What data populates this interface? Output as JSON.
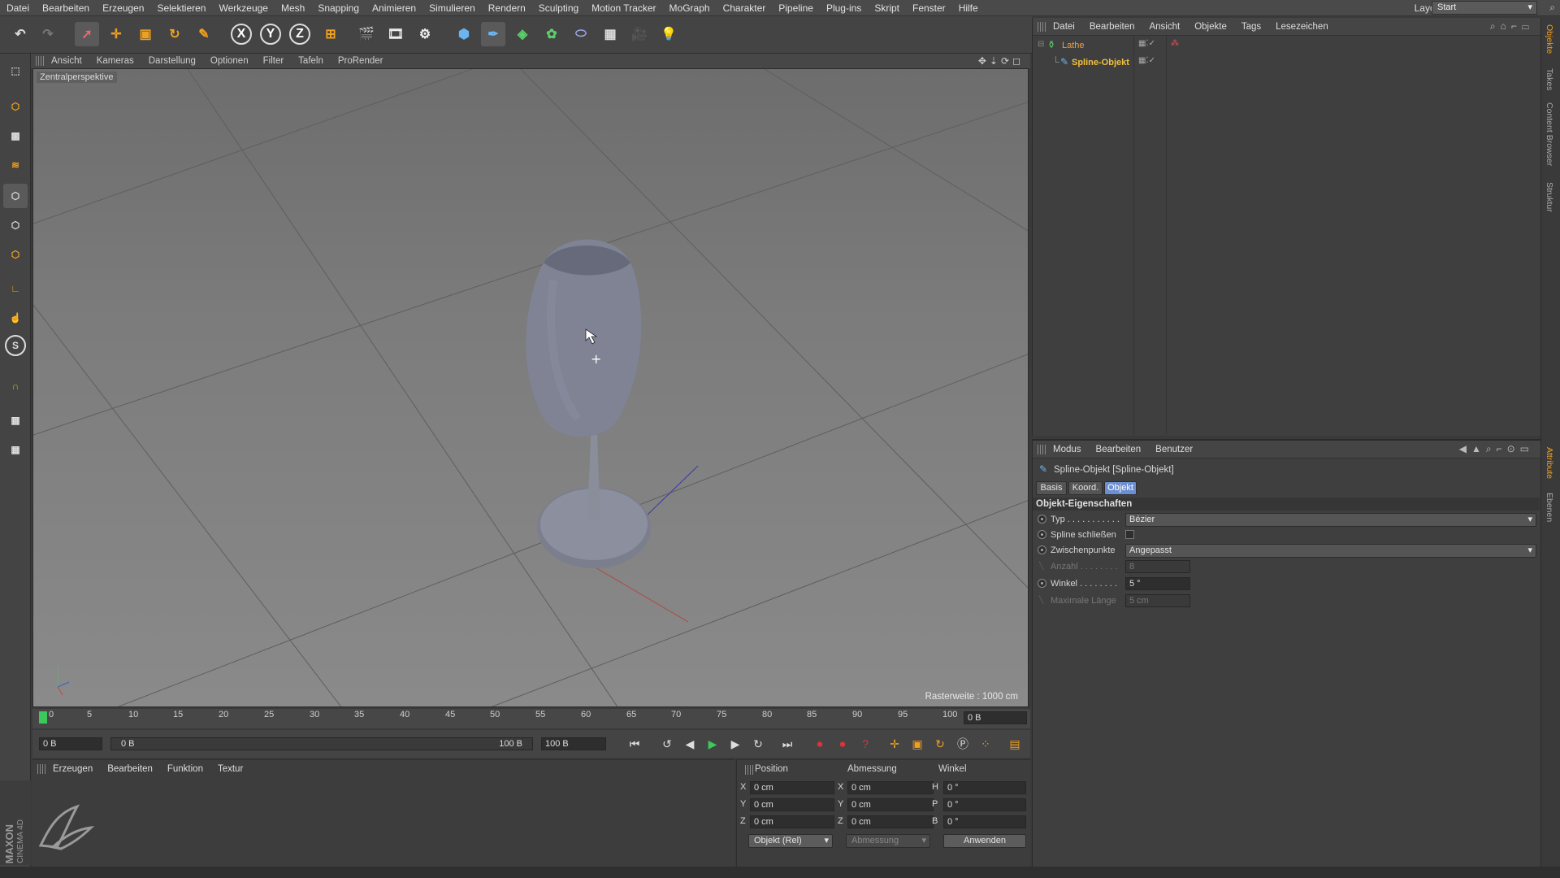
{
  "menubar": {
    "items": [
      "Datei",
      "Bearbeiten",
      "Erzeugen",
      "Selektieren",
      "Werkzeuge",
      "Mesh",
      "Snapping",
      "Animieren",
      "Simulieren",
      "Rendern",
      "Sculpting",
      "Motion Tracker",
      "MoGraph",
      "Charakter",
      "Pipeline",
      "Plug-ins",
      "Skript",
      "Fenster",
      "Hilfe"
    ],
    "layout_label": "Layout:",
    "layout_value": "Start"
  },
  "toolbar": {
    "axis_x": "X",
    "axis_y": "Y",
    "axis_z": "Z"
  },
  "viewport": {
    "menu": [
      "Ansicht",
      "Kameras",
      "Darstellung",
      "Optionen",
      "Filter",
      "Tafeln",
      "ProRender"
    ],
    "camera_label": "Zentralperspektive",
    "raster_label": "Rasterweite : 1000 cm"
  },
  "timeline": {
    "ticks": [
      "0",
      "5",
      "10",
      "15",
      "20",
      "25",
      "30",
      "35",
      "40",
      "45",
      "50",
      "55",
      "60",
      "65",
      "70",
      "75",
      "80",
      "85",
      "90",
      "95",
      "100"
    ],
    "current_frame": "0 B",
    "start_field": "0 B",
    "range_start": "0 B",
    "range_end": "100 B",
    "end_field": "100 B"
  },
  "materials": {
    "menu": [
      "Erzeugen",
      "Bearbeiten",
      "Funktion",
      "Textur"
    ]
  },
  "coords": {
    "headers": [
      "Position",
      "Abmessung",
      "Winkel"
    ],
    "rows": [
      {
        "axis1": "X",
        "pos": "0 cm",
        "axis2": "X",
        "size": "0 cm",
        "axis3": "H",
        "angle": "0 °"
      },
      {
        "axis1": "Y",
        "pos": "0 cm",
        "axis2": "Y",
        "size": "0 cm",
        "axis3": "P",
        "angle": "0 °"
      },
      {
        "axis1": "Z",
        "pos": "0 cm",
        "axis2": "Z",
        "size": "0 cm",
        "axis3": "B",
        "angle": "0 °"
      }
    ],
    "mode_select": "Objekt (Rel)",
    "size_select": "Abmessung",
    "apply_button": "Anwenden"
  },
  "object_manager": {
    "menu": [
      "Datei",
      "Bearbeiten",
      "Ansicht",
      "Objekte",
      "Tags",
      "Lesezeichen"
    ],
    "objects": [
      {
        "name": "Lathe",
        "color": "#e8a04a"
      },
      {
        "name": "Spline-Objekt",
        "color": "#f0c040"
      }
    ]
  },
  "attribute_manager": {
    "menu": [
      "Modus",
      "Bearbeiten",
      "Benutzer"
    ],
    "title": "Spline-Objekt [Spline-Objekt]",
    "tabs": [
      "Basis",
      "Koord.",
      "Objekt"
    ],
    "active_tab": "Objekt",
    "section_title": "Objekt-Eigenschaften",
    "props": {
      "typ_label": "Typ . . . . . . . . . . .",
      "typ_value": "Bézier",
      "close_label": "Spline schließen",
      "inter_label": "Zwischenpunkte",
      "inter_value": "Angepasst",
      "anzahl_label": "Anzahl . . . . . . . .",
      "anzahl_value": "8",
      "winkel_label": "Winkel . . . . . . . .",
      "winkel_value": "5 °",
      "maxlen_label": "Maximale Länge",
      "maxlen_value": "5 cm"
    }
  },
  "side_tabs": [
    "Objekte",
    "Takes",
    "Content Browser",
    "Struktur",
    "Attribute",
    "Ebenen"
  ],
  "branding": {
    "maxon": "MAXON",
    "cinema": "CINEMA 4D"
  },
  "colors": {
    "accent": "#5f8ad6",
    "active_tab": "#6d8fcf",
    "play_green": "#3cc85a",
    "record_red": "#d9343a"
  }
}
